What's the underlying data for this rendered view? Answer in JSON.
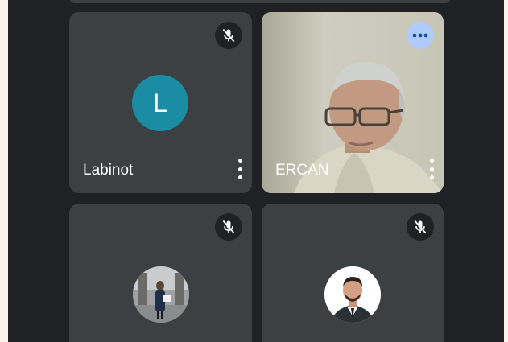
{
  "participants": [
    {
      "name": "Labinot",
      "avatar_letter": "L",
      "avatar_color": "#1a8ca3",
      "muted": true,
      "camera": "off",
      "icon": "mic-off-icon"
    },
    {
      "name": "ERCAN",
      "muted": false,
      "camera": "on",
      "icon": "more-horiz-icon"
    },
    {
      "name": "",
      "muted": true,
      "camera": "off",
      "avatar": "photo",
      "icon": "mic-off-icon"
    },
    {
      "name": "",
      "muted": true,
      "camera": "off",
      "avatar": "photo",
      "icon": "mic-off-icon"
    }
  ],
  "colors": {
    "background": "#202124",
    "tile": "#3c4043",
    "accent_more": "#aecbfa"
  }
}
